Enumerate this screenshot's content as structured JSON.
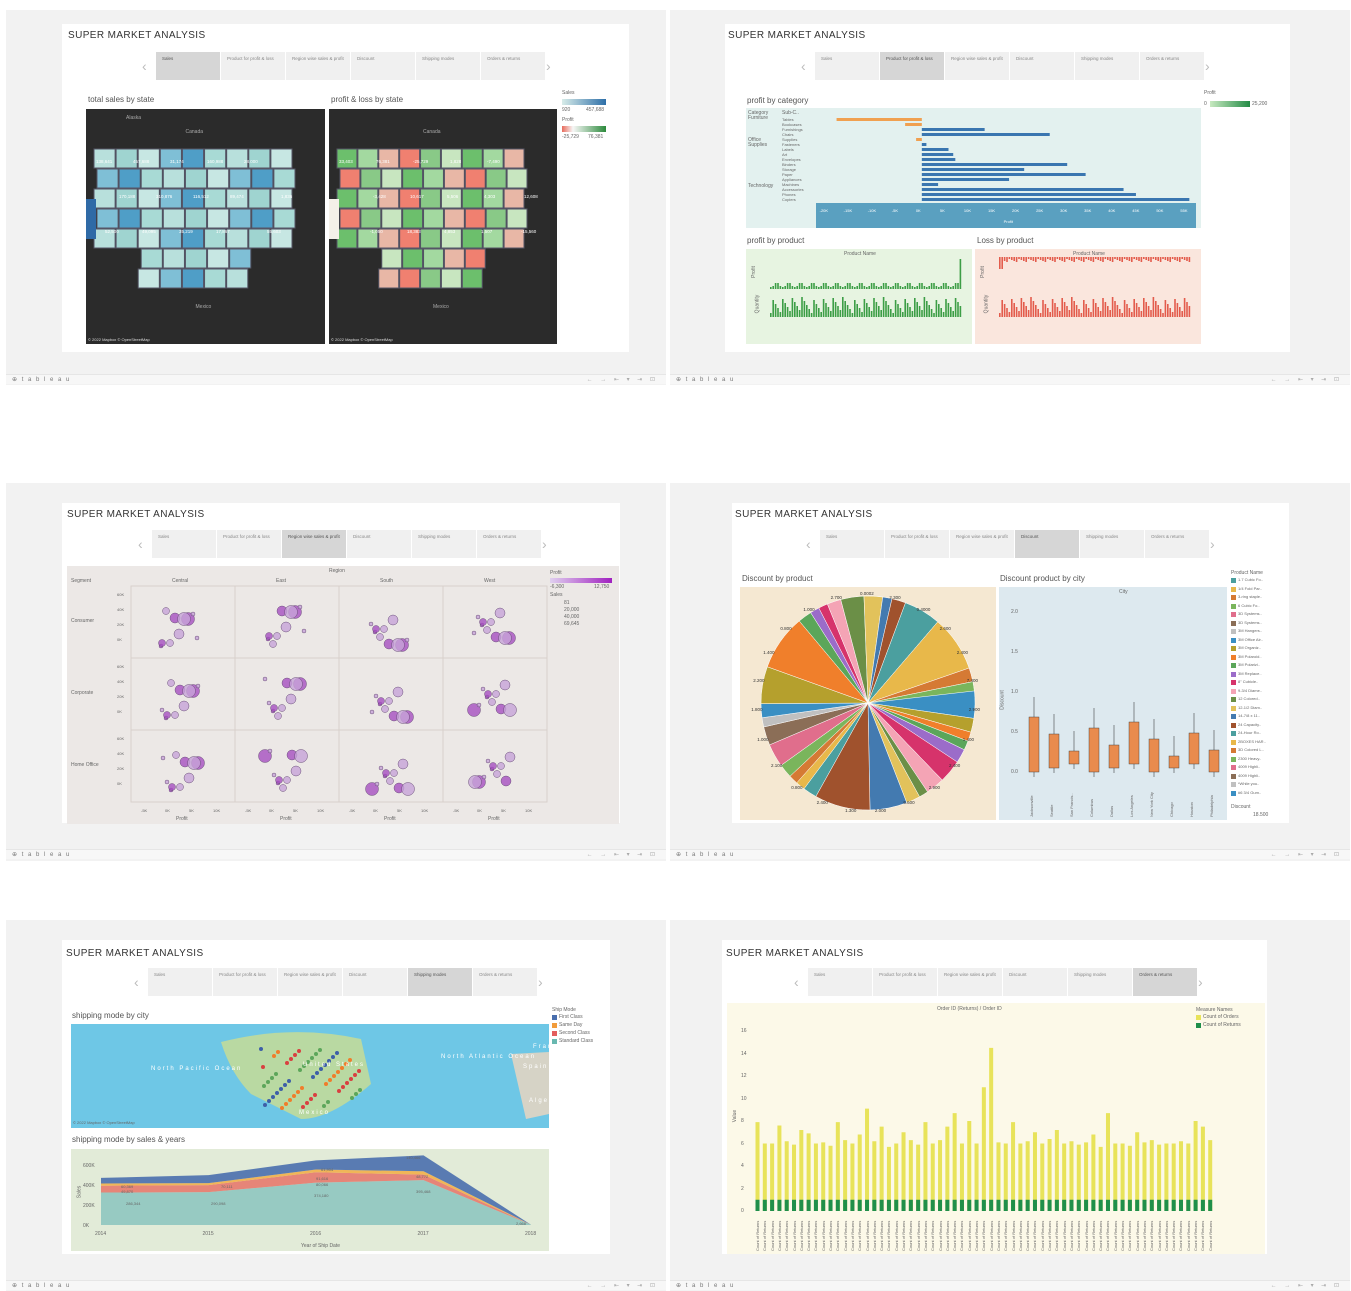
{
  "dashboard_title": "SUPER MARKET ANALYSIS",
  "nav_tabs": [
    "Sales",
    "Product for profit & loss",
    "Region wise sales & profit",
    "Discount",
    "Shipping modes",
    "Orders & returns"
  ],
  "footer_brand": "⊕ t a b l e a u",
  "footer_controls": "← → ⇤ ▾ ⇥ ⊡",
  "sheet1": {
    "active_tab": 0,
    "cap_left": "total sales by state",
    "cap_right": "profit & loss by state",
    "legend_sales_title": "Sales",
    "legend_sales_min": "920",
    "legend_sales_max": "457,688",
    "legend_profit_title": "Profit",
    "legend_profit_min": "-25,729",
    "legend_profit_max": "76,381",
    "map_label_canada": "Canada",
    "map_label_mexico": "Mexico",
    "map_label_alaska": "Alaska",
    "map_credit": "© 2022 Mapbox © OpenStreetMap",
    "sales_state_labels": [
      "138,641",
      "457,688",
      "31,174",
      "160,988",
      "28,000",
      "1,836",
      "170,188",
      "310,876",
      "116,512",
      "89,474",
      "55,603",
      "52,500",
      "49,095",
      "35,219",
      "17,867"
    ],
    "profit_state_labels": [
      "33,403",
      "76,381",
      "-25,729",
      "1,828",
      "-7,490",
      "12,608",
      "-3,428",
      "10,617",
      "5,506",
      "4,303",
      "-15,560",
      "-1,050",
      "18,383",
      "4,853",
      "1,507"
    ]
  },
  "sheet2": {
    "active_tab": 1,
    "cap_category": "profit by category",
    "cap_product": "profit by product",
    "cap_loss": "Loss by product",
    "legend_title": "Profit",
    "legend_min": "0",
    "legend_max": "25,200",
    "col_category": "Category",
    "col_subcat": "Sub-C..",
    "categories": [
      "Furniture",
      "Office Supplies",
      "Technology"
    ],
    "subcats": [
      "Tables",
      "Bookcases",
      "Furnishings",
      "Chairs",
      "Supplies",
      "Fasteners",
      "Labels",
      "Art",
      "Envelopes",
      "Binders",
      "Storage",
      "Paper",
      "Appliances",
      "Machines",
      "Accessories",
      "Phones",
      "Copiers"
    ],
    "axis_ticks": [
      "-20K",
      "-15K",
      "-10K",
      "-5K",
      "0K",
      "5K",
      "10K",
      "15K",
      "20K",
      "25K",
      "30K",
      "35K",
      "40K",
      "45K",
      "50K",
      "55K"
    ],
    "axis_title": "Profit",
    "product_header": "Product Name",
    "label_profit": "Profit",
    "label_quantity": "Quantity"
  },
  "sheet3": {
    "active_tab": 2,
    "region_title": "Region",
    "segment_title": "Segment",
    "regions": [
      "Central",
      "East",
      "South",
      "West"
    ],
    "segments": [
      "Consumer",
      "Corporate",
      "Home Office"
    ],
    "y_ticks": [
      "60K",
      "40K",
      "20K",
      "0K"
    ],
    "x_ticks": [
      "-5K",
      "0K",
      "5K",
      "10K"
    ],
    "x_title": "Profit",
    "y_title": "Sales",
    "legend_profit_title": "Profit",
    "legend_profit_min": "-6,300",
    "legend_profit_max": "12,750",
    "legend_sales_title": "Sales",
    "legend_sales_values": [
      "81",
      "20,000",
      "40,000",
      "69,645"
    ]
  },
  "sheet4": {
    "active_tab": 3,
    "cap_pie": "Discount by product",
    "cap_box": "Discount product by city",
    "box_header": "City",
    "box_y_title": "Discount",
    "box_y_ticks": [
      "2.0",
      "1.5",
      "1.0",
      "0.5",
      "0.0"
    ],
    "cities": [
      "Jacksonville",
      "Seattle",
      "San Francis..",
      "Columbus",
      "Dallas",
      "Los Angeles",
      "New York City",
      "Chicago",
      "Houston",
      "Philadelphia"
    ],
    "pie_labels": [
      "0.0002",
      "2.300",
      "0.4000",
      "2.600",
      "2.400",
      "7.400",
      "2.900",
      "1.400",
      "2.400",
      "2.900",
      "6.600",
      "2.000",
      "1.300",
      "2.400",
      "0.800",
      "2.100",
      "1.000",
      "1.800",
      "2.200",
      "1.400",
      "0.800",
      "1.000",
      "2.700"
    ],
    "legend_title": "Product Name",
    "legend_items": [
      "1.7 Cubic Fo..",
      "1/4 Fold Par..",
      "3-ring staple..",
      "6 Cubic Fo..",
      "3D Systems..",
      "3D Systems..",
      "3M Hangers..",
      "3M Office Air..",
      "3M Organiz..",
      "3M Polaroid..",
      "3M Polarizi..",
      "3M Replace..",
      "8\" Cubicle..",
      "9-3/4 Diame..",
      "12 Colored..",
      "12-1/2 Diam..",
      "14-7/8 x 11..",
      "24 Capacity..",
      "24-Hour Ro..",
      "2BOXES HAR..",
      "3D Colored L..",
      "2300 Heavy..",
      "4009 Highli..",
      "4009 Highli..",
      "*While you..",
      "#6 3/4 Gum.."
    ],
    "legend_discount_title": "Discount",
    "legend_discount_value": "18.500"
  },
  "sheet5": {
    "active_tab": 4,
    "cap_map": "shipping mode by city",
    "cap_area": "shipping mode by sales & years",
    "legend_title": "Ship Mode",
    "ship_modes": [
      "First Class",
      "Same Day",
      "Second Class",
      "Standard Class"
    ],
    "map_labels": [
      "North Pacific Ocean",
      "North Atlantic Ocean",
      "United States",
      "Mexico",
      "Spain",
      "Algeri",
      "Franc"
    ],
    "map_credit": "© 2022 Mapbox © OpenStreetMap",
    "area_y_title": "Sales",
    "area_y_ticks": [
      "600K",
      "400K",
      "200K",
      "0K"
    ],
    "area_x_title": "Year of Ship Date",
    "area_labels": [
      "60,369",
      "49,870",
      "61,904",
      "70,111",
      "91,616",
      "80,066",
      "140,466",
      "48,772",
      "286,344",
      "290,098",
      "374,180",
      "395,468",
      "2,668"
    ]
  },
  "sheet6": {
    "active_tab": 5,
    "header": "Order ID (Returns) / Order ID",
    "y_title": "Value",
    "y_ticks": [
      "16",
      "14",
      "12",
      "10",
      "8",
      "6",
      "4",
      "2",
      "0"
    ],
    "legend_title": "Measure Names",
    "measures": [
      "Count of Orders",
      "Count of Returns"
    ],
    "x_label": "Count of Returns"
  },
  "chart_data": [
    {
      "type": "line",
      "title": "shipping mode by sales & years",
      "xlabel": "Year of Ship Date",
      "ylabel": "Sales",
      "x": [
        "2014",
        "2015",
        "2016",
        "2017",
        "2018"
      ],
      "ylim": [
        0,
        600000
      ],
      "series": [
        {
          "name": "Standard Class",
          "values": [
            286344,
            290098,
            374180,
            395468,
            2668
          ]
        },
        {
          "name": "Second Class",
          "values": [
            60369,
            61904,
            91616,
            48772,
            0
          ]
        },
        {
          "name": "Same Day",
          "values": [
            19000,
            18000,
            24000,
            30000,
            0
          ]
        },
        {
          "name": "First Class",
          "values": [
            49870,
            70111,
            80066,
            140466,
            0
          ]
        }
      ]
    },
    {
      "type": "bar",
      "title": "Orders & returns",
      "ylabel": "Value",
      "ylim": [
        0,
        16
      ],
      "series": [
        {
          "name": "Count of Orders",
          "values": [
            7.9,
            6.0,
            6.0,
            7.6,
            6.2,
            5.9,
            7.2,
            6.9,
            6.0,
            6.1,
            5.8,
            7.9,
            6.3,
            6.0,
            6.8,
            9.1,
            6.2,
            7.5,
            5.7,
            6.0,
            7.0,
            6.3,
            5.9,
            7.9,
            6.0,
            6.3,
            7.5,
            8.7,
            6.0,
            8.0,
            6.0,
            11.0,
            14.5,
            6.1,
            6.0,
            7.9,
            6.0,
            6.2,
            7.0,
            6.0,
            6.4,
            7.2,
            6.0,
            6.2,
            5.9,
            6.1,
            6.8,
            5.7,
            8.7,
            6.0,
            6.0,
            5.8,
            7.0,
            6.1,
            6.3,
            5.9,
            6.0,
            6.0,
            6.2,
            6.0,
            8.0,
            7.5,
            6.3
          ]
        },
        {
          "name": "Count of Returns",
          "values": [
            1,
            1,
            1,
            1,
            1,
            1,
            1,
            1,
            1,
            1,
            1,
            1,
            1,
            1,
            1,
            1,
            1,
            1,
            1,
            1,
            1,
            1,
            1,
            1,
            1,
            1,
            1,
            1,
            1,
            1,
            1,
            1,
            1,
            1,
            1,
            1,
            1,
            1,
            1,
            1,
            1,
            1,
            1,
            1,
            1,
            1,
            1,
            1,
            1,
            1,
            1,
            1,
            1,
            1,
            1,
            1,
            1,
            1,
            1,
            1,
            1,
            1,
            1
          ]
        }
      ]
    },
    {
      "type": "bar",
      "title": "profit by category",
      "xlabel": "Profit",
      "categories": [
        "Tables",
        "Bookcases",
        "Furnishings",
        "Chairs",
        "Supplies",
        "Fasteners",
        "Labels",
        "Art",
        "Envelopes",
        "Binders",
        "Storage",
        "Paper",
        "Appliances",
        "Machines",
        "Accessories",
        "Phones",
        "Copiers"
      ],
      "values": [
        -17725,
        -3473,
        13059,
        26590,
        -1189,
        950,
        5546,
        6528,
        6964,
        30222,
        21279,
        34054,
        18138,
        3385,
        41937,
        44516,
        55618
      ]
    }
  ]
}
